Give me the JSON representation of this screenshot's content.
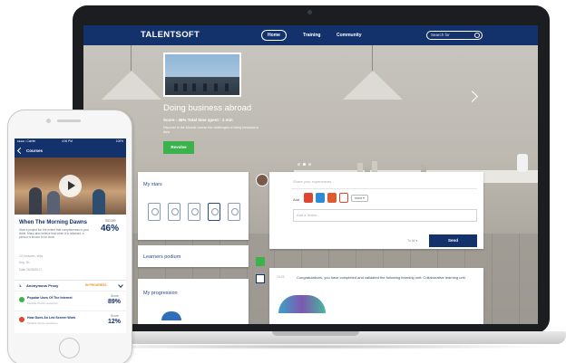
{
  "laptop": {
    "logo": "TALENTSOFT",
    "nav": {
      "home": "Home",
      "training": "Training",
      "community": "Community",
      "search_placeholder": "Search for"
    },
    "hero": {
      "title": "Doing business abroad",
      "meta": "Score : 46% Total time spent : 1 min",
      "description": "Discover in the Module course the challenges of doing business in Asia",
      "button": "Revolve"
    },
    "widgets": {
      "my_stars": "My stars",
      "learners_podium": "Learners podium",
      "my_progression": "My progression"
    },
    "post": {
      "placeholder": "Share your experiences",
      "add_label": "Add",
      "more_button": "more ▾",
      "link_placeholder": "Add a Notes...",
      "visibility": "To all ▾",
      "send_button": "Send"
    },
    "feed": {
      "date": "10:23",
      "text": "Congratulations, you have completed and validated the following learning unit: Collaborative learning unit"
    }
  },
  "phone": {
    "status_left": "●●●●○ Carrier",
    "status_time": "4:06 PM",
    "status_right": "100%",
    "header": "Courses",
    "course_title": "When The Morning Dawns",
    "course_desc": "Start a project fun the extent that completeness is your tickle. Many also believe that when it is obtained, a person is known to be clear.",
    "score_label": "Score",
    "score_value": "46%",
    "meta1": "13 Lectures, ents",
    "meta2": "Avg. 3h",
    "meta3": "Date  26/05/2017",
    "section": {
      "num": "1.",
      "title": "Anonymous Proxy",
      "status": "IN PROGRESS"
    },
    "lessons": [
      {
        "title": "Popular Uses Of The Internet",
        "sub": "Multiple choice questions",
        "score_label": "Score",
        "score": "89%",
        "color": "#3bb24c"
      },
      {
        "title": "How Does An Led Screen Work",
        "sub": "Multiple choice questions",
        "score_label": "Score",
        "score": "12%",
        "color": "#e0452f"
      }
    ]
  },
  "colors": {
    "brand_navy": "#13316b",
    "accent_green": "#3bb24c",
    "status_orange": "#e0952b"
  }
}
